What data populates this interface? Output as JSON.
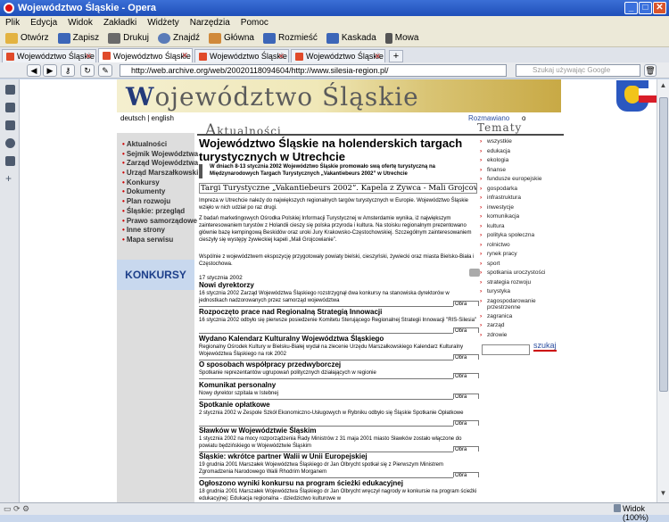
{
  "window": {
    "title": "Województwo Śląskie - Opera"
  },
  "menu": [
    "Plik",
    "Edycja",
    "Widok",
    "Zakładki",
    "Widżety",
    "Narzędzia",
    "Pomoc"
  ],
  "toolbar": [
    {
      "label": "Otwórz",
      "icon": "folder-open-icon",
      "color": "#e3b341"
    },
    {
      "label": "Zapisz",
      "icon": "save-icon",
      "color": "#3c66b8"
    },
    {
      "label": "Drukuj",
      "icon": "print-icon",
      "color": "#6a6a6a"
    },
    {
      "label": "Znajdź",
      "icon": "search-icon",
      "color": "#5a7bb8"
    },
    {
      "label": "Główna",
      "icon": "home-icon",
      "color": "#d0893a"
    },
    {
      "label": "Rozmieść",
      "icon": "tile-icon",
      "color": "#3c66b8"
    },
    {
      "label": "Kaskada",
      "icon": "cascade-icon",
      "color": "#3c66b8"
    },
    {
      "label": "Mowa",
      "icon": "microphone-icon",
      "color": "#555555"
    }
  ],
  "tabs": [
    {
      "label": "Województwo Śląskie",
      "active": false
    },
    {
      "label": "Województwo Śląskie",
      "active": true
    },
    {
      "label": "Województwo Śląskie",
      "active": false
    },
    {
      "label": "Województwo Śląskie",
      "active": false
    }
  ],
  "address": {
    "url": "http://web.archive.org/web/20020118094604/http://www.silesia-region.pl/",
    "search_placeholder": "Szukaj używając Google"
  },
  "status": {
    "zoom": "Widok (100%)"
  },
  "page": {
    "banner_prefix": "W",
    "banner_rest": "ojewództwo Śląskie",
    "lang_links": "deutsch | english",
    "rozmawiano": "Rozmawiano",
    "rozmawiano_value": "o",
    "section_left": "Aktualności",
    "section_right": "Tematy",
    "nav": [
      "Aktualności",
      "Sejmik Województwa",
      "Zarząd Województwa",
      "Urząd Marszałkowski",
      "Konkursy",
      "Dokumenty",
      "Plan rozwoju",
      "Śląskie: przegląd",
      "Prawo samorządowe",
      "Inne strony",
      "Mapa serwisu"
    ],
    "konkurs_banner": "KONKURSY",
    "main_title": "Województwo Śląskie na holenderskich targach turystycznych w Utrechcie",
    "lead": "W dniach 8-13 stycznia 2002 Województwo Śląskie promowało swą ofertę turystyczną na Międzynarodowych Targach Turystycznych „Vakantiebeurs 2002” w Utrechcie",
    "ticker": "Targi Turystyczne „Vakantiebeurs 2002”. Kapela z Żywca - Mali Grojcowianie © BT",
    "paragraphs": [
      "Impreza w Utrechcie należy do największych regionalnych targów turystycznych w Europie. Województwo Śląskie wzięło w nich udział po raz drugi.",
      "Z badań marketingowych Ośrodka Polskiej Informacji Turystycznej w Amsterdamie wynika, iż największym zainteresowaniem turystów z Holandii cieszy się polska przyroda i kultura. Na stoisku regionalnym prezentowano głównie bazę kempingową Beskidów oraz uroki Jury Krakowsko-Częstochowskiej. Szczególnym zainteresowaniem cieszyły się występy żywieckiej kapeli „Mali Grojcowianie”.",
      "Wspólnie z województwem ekspozycję przygotowały powiaty bielski, cieszyński, żywiecki oraz miasta Bielsko-Biała i Częstochowa."
    ],
    "date": "17 stycznia 2002",
    "more_label": "Obra",
    "news": [
      {
        "title": "Nowi dyrektorzy",
        "desc": "16 stycznia 2002 Zarząd Województwa Śląskiego rozstrzygnął dwa konkursy na stanowiska dyrektorów w jednostkach nadzorowanych przez samorząd województwa"
      },
      {
        "title": "Rozpoczęto prace nad Regionalną Strategią Innowacji",
        "desc": "16 stycznia 2002 odbyło się pierwsze posiedzenie Komitetu Sterującego Regionalnej Strategii Innowacji \"RIS-Silesia\""
      },
      {
        "title": "Wydano Kalendarz Kulturalny Województwa Śląskiego",
        "desc": "Regionalny Ośrodek Kultury w Bielsku-Białej wydał na zlecenie Urzędu Marszałkowskiego Kalendarz Kulturalny Województwa Śląskiego na rok 2002"
      },
      {
        "title": "O sposobach współpracy przedwyborczej",
        "desc": "Spotkanie reprezentantów ugrupowań politycznych działających w regionie"
      },
      {
        "title": "Komunikat personalny",
        "desc": "Nowy dyrektor szpitala w Istebnej"
      },
      {
        "title": "Spotkanie opłatkowe",
        "desc": "2 stycznia 2002 w Zespole Szkół Ekonomiczno-Usługowych w Rybniku odbyło się Śląskie Spotkanie Opłatkowe"
      },
      {
        "title": "Sławków w Województwie Śląskim",
        "desc": "1 stycznia 2002 na mocy rozporządzenia Rady Ministrów z 31 maja 2001 miasto Sławków zostało włączone do powiatu będzińskiego w Województwie Śląskim"
      },
      {
        "title": "Śląskie: wkrótce partner Walii w Unii Europejskiej",
        "desc": "19 grudnia 2001 Marszałek Województwa Śląskiego dr Jan Olbrycht spotkał się z Pierwszym Ministrem Zgromadzenia Narodowego Walii Rhodrim Morganem"
      },
      {
        "title": "Ogłoszono wyniki konkursu na program ścieżki edukacyjnej",
        "desc": "18 grudnia 2001 Marszałek Województwa Śląskiego dr Jan Olbrycht wręczył nagrody w konkursie na program ścieżki edukacyjnej: Edukacja regionalna - dziedzictwo kulturowe w"
      }
    ],
    "tematy": [
      "wszystkie",
      "edukacja",
      "ekologia",
      "finanse",
      "fundusze europejskie",
      "gospodarka",
      "infrastruktura",
      "inwestycje",
      "komunikacja",
      "kultura",
      "polityka społeczna",
      "rolnictwo",
      "rynek pracy",
      "sport",
      "spotkania uroczystości",
      "strategia rozwoju",
      "turystyka",
      "zagospodarowanie przestrzenne",
      "zagranica",
      "zarząd",
      "zdrowie"
    ],
    "search_button": "szukaj"
  },
  "colors": {
    "titlebar": "#1f4fb9",
    "accent_red": "#cc0000",
    "link_blue": "#2c4fa0",
    "nav_bg": "#dddddd"
  }
}
